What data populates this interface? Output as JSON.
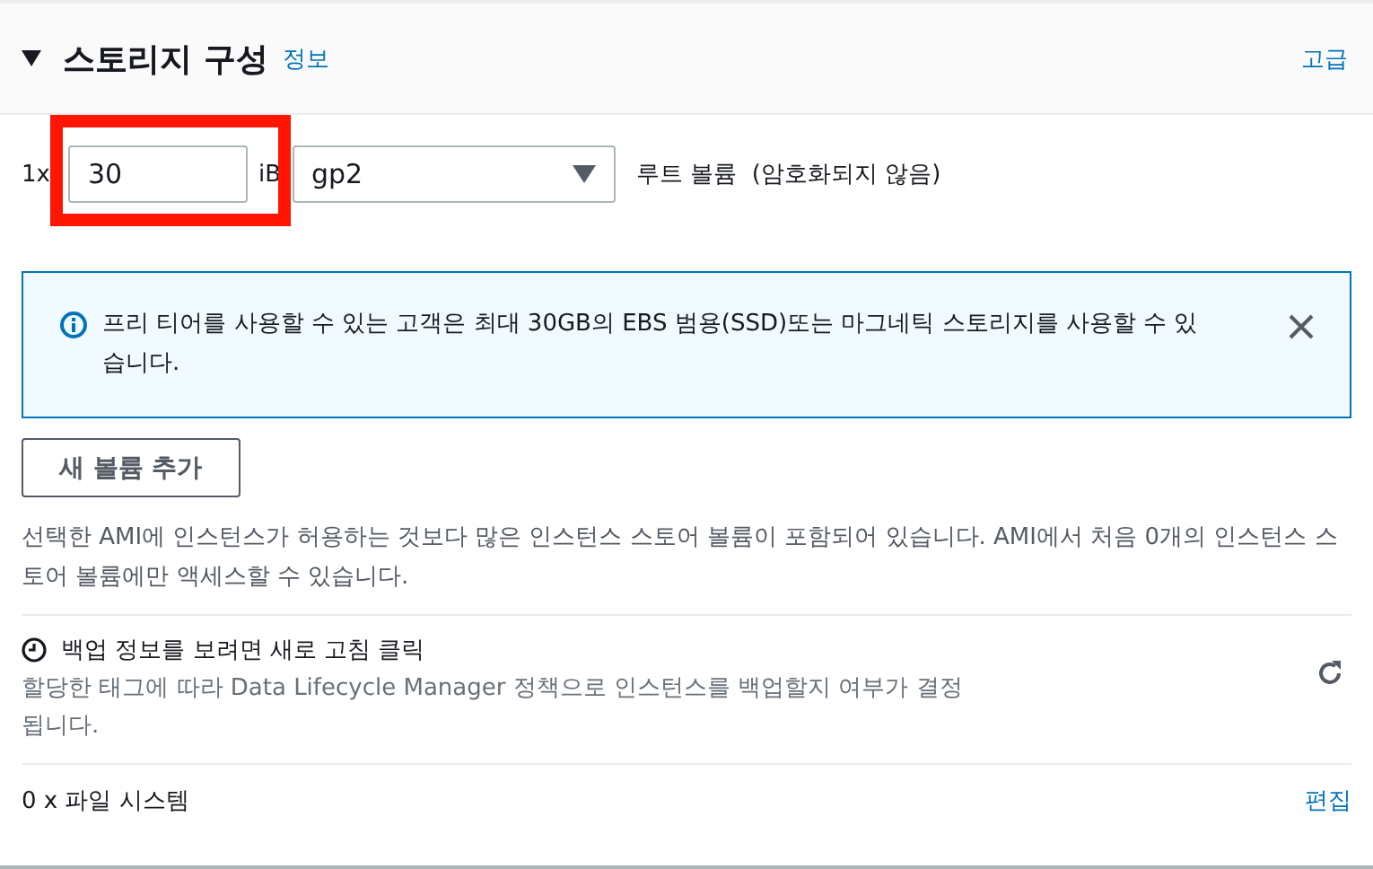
{
  "section": {
    "title": "스토리지 구성",
    "info_link": "정보",
    "advanced_link": "고급",
    "expanded": true
  },
  "volume": {
    "count_label": "1x",
    "size": "30",
    "highlighted": true,
    "unit_label": "iB",
    "type": "gp2",
    "description": "루트 볼륨  (암호화되지 않음)"
  },
  "alert": {
    "text": "프리 티어를 사용할 수 있는 고객은 최대 30GB의 EBS 범용(SSD)또는 마그네틱 스토리지를 사용할 수 있습니다."
  },
  "add_button": "새 볼륨 추가",
  "instance_store_note": "선택한 AMI에 인스턴스가 허용하는 것보다 많은 인스턴스 스토어 볼륨이 포함되어 있습니다. AMI에서 처음 0개의 인스턴스 스토어 볼륨에만 액세스할 수 있습니다.",
  "backup": {
    "title": "백업 정보를 보려면 새로 고침 클릭",
    "description": "할당한 태그에 따라 Data Lifecycle Manager 정책으로 인스턴스를 백업할지 여부가 결정\n됩니다."
  },
  "file_systems": {
    "label": "0 x 파일 시스템",
    "edit_link": "편집"
  }
}
